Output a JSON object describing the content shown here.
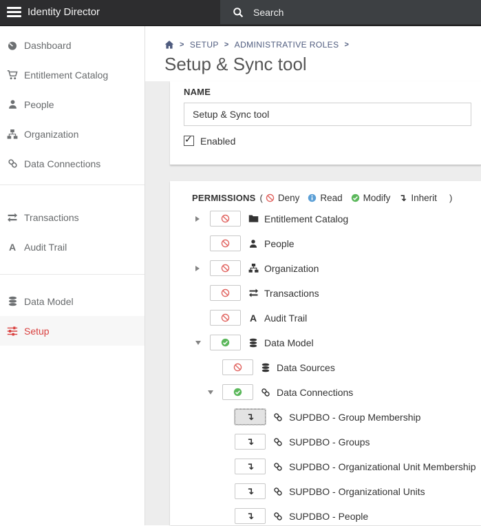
{
  "topbar": {
    "app_title": "Identity Director",
    "search_placeholder": "Search"
  },
  "sidebar": {
    "sections": [
      {
        "items": [
          {
            "icon": "gauge-icon",
            "label": "Dashboard"
          },
          {
            "icon": "cart-icon",
            "label": "Entitlement Catalog"
          },
          {
            "icon": "user-icon",
            "label": "People"
          },
          {
            "icon": "sitemap-icon",
            "label": "Organization"
          },
          {
            "icon": "link-icon",
            "label": "Data Connections"
          }
        ]
      },
      {
        "items": [
          {
            "icon": "exchange-icon",
            "label": "Transactions"
          },
          {
            "icon": "audit-icon",
            "label": "Audit Trail"
          }
        ]
      },
      {
        "items": [
          {
            "icon": "database-icon",
            "label": "Data Model"
          },
          {
            "icon": "sliders-icon",
            "label": "Setup",
            "active": true
          }
        ]
      }
    ]
  },
  "breadcrumb": {
    "items": [
      "SETUP",
      "ADMINISTRATIVE ROLES"
    ]
  },
  "page": {
    "title": "Setup & Sync tool"
  },
  "form": {
    "name_label": "NAME",
    "name_value": "Setup & Sync tool",
    "enabled_label": "Enabled",
    "enabled_checked": true
  },
  "permissions": {
    "label": "PERMISSIONS",
    "legend_open": "(",
    "legend_close": ")",
    "legend": [
      {
        "state": "deny",
        "label": "Deny"
      },
      {
        "state": "read",
        "label": "Read"
      },
      {
        "state": "modify",
        "label": "Modify"
      },
      {
        "state": "inherit",
        "label": "Inherit"
      }
    ],
    "inherit_glyph": "↴",
    "tree": [
      {
        "level": 0,
        "expand": "collapsed",
        "state": "deny",
        "icon": "folder-icon",
        "label": "Entitlement Catalog"
      },
      {
        "level": 0,
        "expand": "none",
        "state": "deny",
        "icon": "user-icon",
        "label": "People"
      },
      {
        "level": 0,
        "expand": "collapsed",
        "state": "deny",
        "icon": "sitemap-icon",
        "label": "Organization"
      },
      {
        "level": 0,
        "expand": "none",
        "state": "deny",
        "icon": "exchange-icon",
        "label": "Transactions"
      },
      {
        "level": 0,
        "expand": "none",
        "state": "deny",
        "icon": "audit-icon",
        "label": "Audit Trail"
      },
      {
        "level": 0,
        "expand": "expanded",
        "state": "modify",
        "icon": "database-icon",
        "label": "Data Model"
      },
      {
        "level": 1,
        "expand": "none",
        "state": "deny",
        "icon": "database-icon",
        "label": "Data Sources"
      },
      {
        "level": 1,
        "expand": "expanded",
        "state": "modify",
        "icon": "link-icon",
        "label": "Data Connections"
      },
      {
        "level": 2,
        "expand": "none",
        "state": "inherit",
        "icon": "link-icon",
        "label": "SUPDBO - Group Membership",
        "focused": true
      },
      {
        "level": 2,
        "expand": "none",
        "state": "inherit",
        "icon": "link-icon",
        "label": "SUPDBO - Groups"
      },
      {
        "level": 2,
        "expand": "none",
        "state": "inherit",
        "icon": "link-icon",
        "label": "SUPDBO - Organizational Unit Membership"
      },
      {
        "level": 2,
        "expand": "none",
        "state": "inherit",
        "icon": "link-icon",
        "label": "SUPDBO - Organizational Units"
      },
      {
        "level": 2,
        "expand": "none",
        "state": "inherit",
        "icon": "link-icon",
        "label": "SUPDBO - People"
      }
    ]
  },
  "colors": {
    "topbar_bg": "#2d2d2f",
    "search_bg": "#3d4043",
    "deny_red": "#e0605c",
    "read_blue": "#5b9fd6",
    "modify_green": "#5cb85c",
    "accent_red": "#d9403f",
    "breadcrumb_blue": "#4e5b7e"
  }
}
